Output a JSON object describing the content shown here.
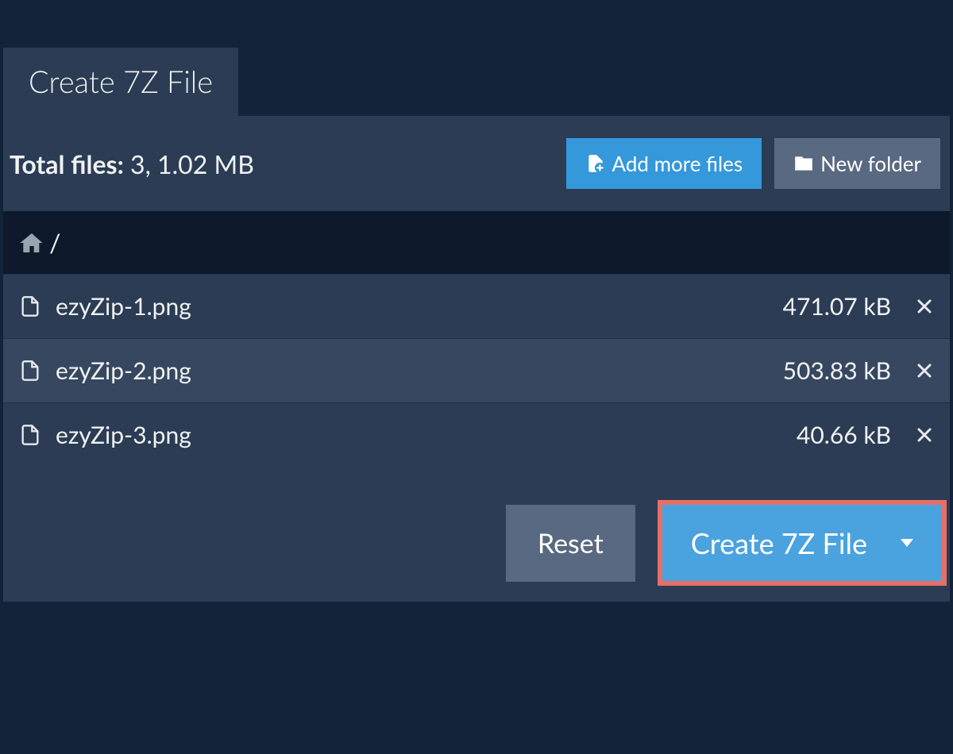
{
  "tab": {
    "title": "Create 7Z File"
  },
  "toolbar": {
    "total_files_label": "Total files:",
    "total_files_value": " 3, 1.02 MB",
    "add_files_label": "Add more files",
    "new_folder_label": "New folder"
  },
  "breadcrumb": {
    "separator": "/"
  },
  "files": [
    {
      "name": "ezyZip-1.png",
      "size": "471.07 kB"
    },
    {
      "name": "ezyZip-2.png",
      "size": "503.83 kB"
    },
    {
      "name": "ezyZip-3.png",
      "size": "40.66 kB"
    }
  ],
  "actions": {
    "reset_label": "Reset",
    "create_label": "Create 7Z File"
  }
}
